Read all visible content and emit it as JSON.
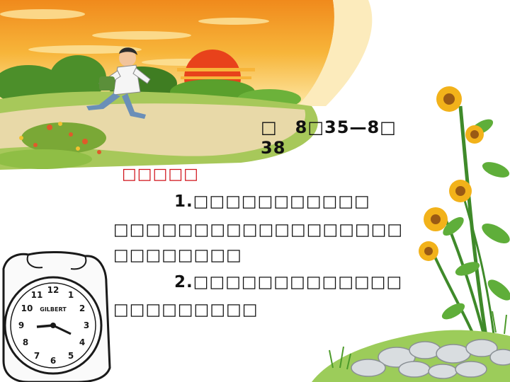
{
  "slide": {
    "time_line_1": "□　8□35—8□",
    "time_line_2": "38",
    "heading": "□□□□□",
    "item1_line1": "1.□□□□□□□□□□□",
    "item1_line2": "□□□□□□□□□□□□□□□□□□",
    "item1_line3": "□□□□□□□□",
    "item2_line1": "2.□□□□□□□□□□□□□",
    "item2_line2": "□□□□□□□□□"
  },
  "clock": {
    "brand": "GILBERT",
    "numerals": [
      "12",
      "1",
      "2",
      "3",
      "4",
      "5",
      "6",
      "7",
      "8",
      "9",
      "10",
      "11"
    ]
  },
  "colors": {
    "heading": "#d0121a",
    "sky_orange": "#f5a623",
    "sun_red": "#e8421b",
    "grass_green": "#5aa02c",
    "path_tan": "#e8d9a8"
  }
}
